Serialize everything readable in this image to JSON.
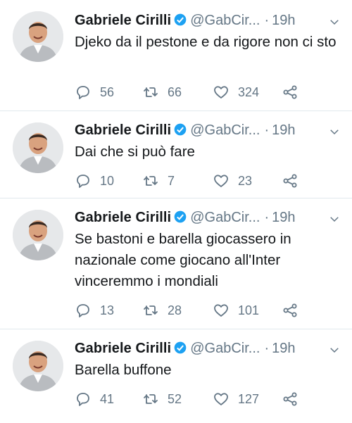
{
  "tweets": [
    {
      "name": "Gabriele Cirilli",
      "handle": "@GabCir...",
      "dot": "·",
      "time": "19h",
      "text": "Djeko da il pestone e da rigore non ci sto",
      "replies": "56",
      "retweets": "66",
      "likes": "324"
    },
    {
      "name": "Gabriele Cirilli",
      "handle": "@GabCir...",
      "dot": "·",
      "time": "19h",
      "text": "Dai che si può fare",
      "replies": "10",
      "retweets": "7",
      "likes": "23"
    },
    {
      "name": "Gabriele Cirilli",
      "handle": "@GabCir...",
      "dot": "·",
      "time": "19h",
      "text": "Se bastoni e barella giocassero in nazionale come giocano all'Inter vinceremmo i mondiali",
      "replies": "13",
      "retweets": "28",
      "likes": "101"
    },
    {
      "name": "Gabriele Cirilli",
      "handle": "@GabCir...",
      "dot": "·",
      "time": "19h",
      "text": "Barella buffone",
      "replies": "41",
      "retweets": "52",
      "likes": "127"
    }
  ],
  "icons": {
    "reply": "reply-icon",
    "retweet": "retweet-icon",
    "like": "heart-icon",
    "share": "share-icon",
    "verified": "verified-badge-icon",
    "menu": "chevron-down-icon"
  },
  "colors": {
    "text": "#14171a",
    "secondary": "#657786",
    "verified": "#1da1f2",
    "divider": "#e1e8ed"
  }
}
